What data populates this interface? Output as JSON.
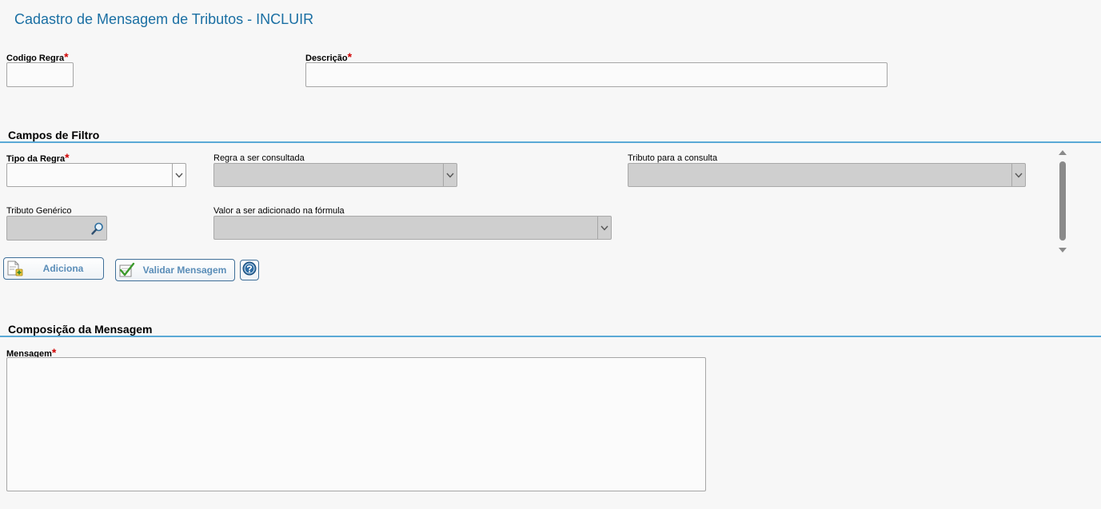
{
  "header": {
    "title": "Cadastro de Mensagem de Tributos - INCLUIR"
  },
  "form": {
    "codigo_regra": {
      "label": "Codigo Regra",
      "required_mark": "*",
      "value": ""
    },
    "descricao": {
      "label": "Descrição",
      "required_mark": "*",
      "value": ""
    }
  },
  "filtro": {
    "section_title": "Campos de Filtro",
    "tipo_regra": {
      "label": "Tipo da Regra",
      "required_mark": "*",
      "value": ""
    },
    "regra_consultada": {
      "label": "Regra a ser consultada",
      "value": ""
    },
    "tributo_consulta": {
      "label": "Tributo para a consulta",
      "value": ""
    },
    "tributo_generico": {
      "label": "Tributo Genérico",
      "value": ""
    },
    "valor_formula": {
      "label": "Valor a ser adicionado na fórmula",
      "value": ""
    },
    "buttons": {
      "adiciona": "Adiciona",
      "validar": "Validar Mensagem"
    }
  },
  "composicao": {
    "section_title": "Composição da Mensagem",
    "mensagem": {
      "label": "Mensagem",
      "required_mark": "*",
      "value": ""
    }
  },
  "icons": {
    "add": "add-document-icon",
    "validate": "checkmark-document-icon",
    "help": "help-icon",
    "lookup": "magnifier-icon",
    "dropdown": "chevron-down-icon"
  },
  "colors": {
    "title": "#1a6fa3",
    "section_line": "#5aa9d6",
    "required": "#d00000",
    "disabled_field": "#cfcfcf",
    "button_text": "#5a8db8"
  }
}
